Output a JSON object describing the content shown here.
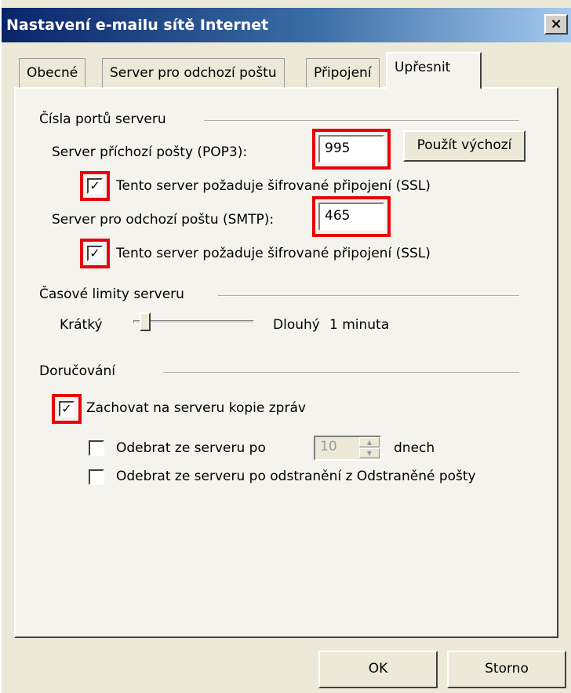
{
  "window": {
    "title": "Nastavení e-mailu sítě Internet",
    "close_glyph": "×"
  },
  "tabs": [
    {
      "label": "Obecné",
      "active": false
    },
    {
      "label": "Server pro odchozí poštu",
      "active": false
    },
    {
      "label": "Připojení",
      "active": false
    },
    {
      "label": "Upřesnit",
      "active": true
    }
  ],
  "ports": {
    "heading": "Čísla portů serveru",
    "incoming_label": "Server příchozí pošty (POP3):",
    "incoming_value": "995",
    "default_button": "Použít výchozí",
    "incoming_ssl_label": "Tento server požaduje šifrované připojení (SSL)",
    "incoming_ssl_checked": true,
    "outgoing_label": "Server pro odchozí poštu (SMTP):",
    "outgoing_value": "465",
    "outgoing_ssl_label": "Tento server požaduje šifrované připojení (SSL)",
    "outgoing_ssl_checked": true
  },
  "timeouts": {
    "heading": "Časové limity serveru",
    "short_label": "Krátký",
    "long_label": "Dlouhý",
    "value_text": "1 minuta",
    "slider_level": 0.1
  },
  "delivery": {
    "heading": "Doručování",
    "keep_copy_label": "Zachovat na serveru kopie zpráv",
    "keep_copy_checked": true,
    "remove_after_label": "Odebrat ze serveru po",
    "remove_after_checked": false,
    "remove_after_days": "10",
    "days_unit": "dnech",
    "remove_deleted_label": "Odebrat ze serveru po odstranění z Odstraněné pošty",
    "remove_deleted_checked": false
  },
  "buttons": {
    "ok": "OK",
    "cancel": "Storno"
  },
  "colors": {
    "highlight": "#e8000b",
    "title_start": "#0a246a",
    "title_end": "#a6caf0",
    "dialog_bg": "#ece9d8"
  }
}
